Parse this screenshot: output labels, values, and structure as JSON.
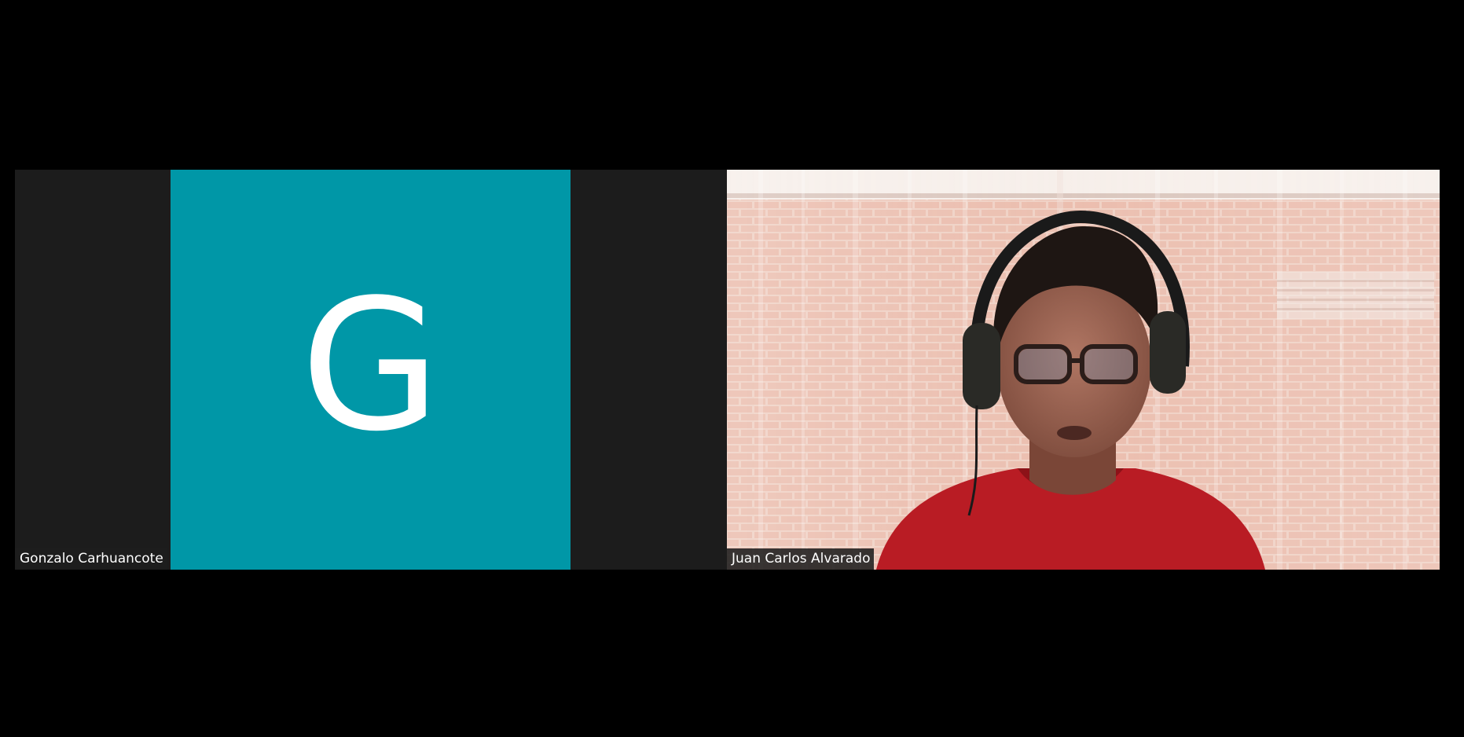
{
  "meeting": {
    "participants": [
      {
        "name": "Gonzalo Carhuancote",
        "video": "off",
        "avatar_initial": "G",
        "avatar_color": "#0097a7"
      },
      {
        "name": "Juan Carlos Alvarado",
        "video": "on",
        "icon": "participant-video-feed"
      }
    ]
  },
  "colors": {
    "background": "#000000",
    "tile_background": "#1c1c1c",
    "avatar": "#0097a7",
    "label_background": "#1e1e1e",
    "label_text": "#ffffff"
  }
}
